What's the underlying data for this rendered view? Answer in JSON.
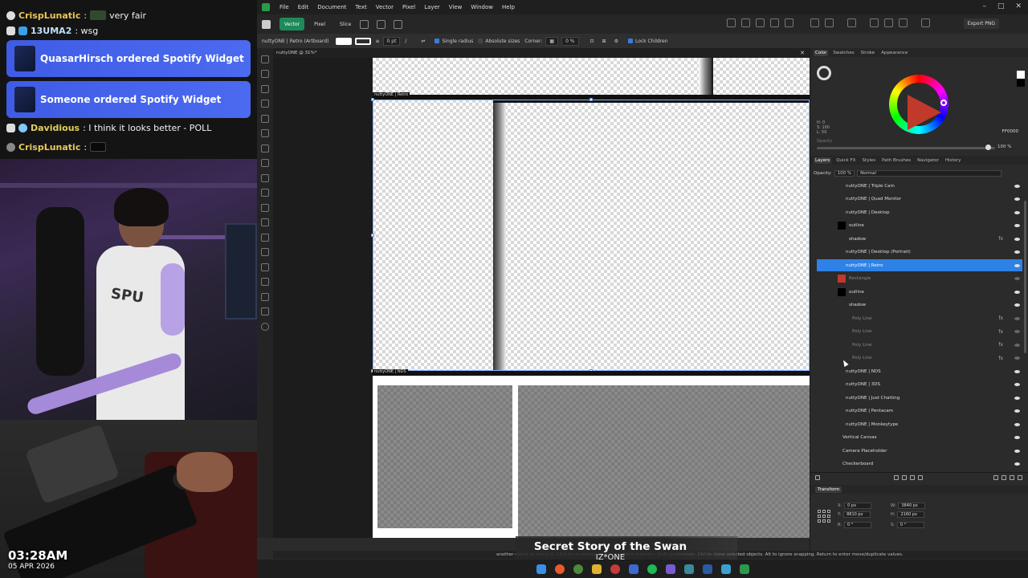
{
  "stream": {
    "chat": [
      {
        "user": "CrispLunatic",
        "message": "very fair",
        "has_emote": true
      },
      {
        "user": "13UMA2",
        "message": ": wsg",
        "has_emote": false
      },
      {
        "user": "Davidious",
        "message": ": I think it looks better - POLL",
        "has_emote": false
      },
      {
        "user": "CrispLunatic",
        "message": ":",
        "has_emote": true
      }
    ],
    "alerts": [
      {
        "text": "QuasarHirsch ordered Spotify Widget"
      },
      {
        "text": "Someone ordered Spotify Widget"
      }
    ],
    "clock": "03:28AM",
    "date": "05 APR 2026",
    "now_playing": {
      "title": "Secret Story of the Swan",
      "artist": "IZ*ONE"
    }
  },
  "app": {
    "menu": [
      "File",
      "Edit",
      "Document",
      "Text",
      "Vector",
      "Pixel",
      "Layer",
      "View",
      "Window",
      "Help"
    ],
    "personas": [
      {
        "label": "Vector",
        "active": true
      },
      {
        "label": "Pixel",
        "active": false
      },
      {
        "label": "Slice",
        "active": false
      }
    ],
    "export_label": "Export PNG",
    "context": {
      "selection_name": "nuttyONE | Retro (Artboard)",
      "stroke_width": "0 pt",
      "single_radius": "Single radius",
      "absolute_sizes": "Absolute sizes",
      "corner_label": "Corner:",
      "corner_value": "0 %",
      "lock_children": "Lock Children"
    },
    "doc_tab": "nuttyONE @ 31%*",
    "artboard_labels": [
      "nuttyONE | Retro",
      "nuttyONE | NDS"
    ],
    "status_text": "another object to select it. Click on an empty area to deselect selection. Shift to constrain. Ctrl to clone selected objects. Alt to ignore snapping. Return to enter move/duplicate values."
  },
  "panels": {
    "color_tabs": [
      "Color",
      "Swatches",
      "Stroke",
      "Appearance"
    ],
    "color": {
      "h": "H: 0",
      "s": "S: 100",
      "l": "L: 50",
      "hex": "FF0000",
      "opacity_label": "Opacity",
      "opacity_value": "100 %",
      "accent": "#ff0000"
    },
    "layer_tabs": [
      "Layers",
      "Quick FX",
      "Styles",
      "Path Brushes",
      "Navigator",
      "History"
    ],
    "layer_opacity_label": "Opacity:",
    "layer_opacity": "100 %",
    "blend_mode": "Normal",
    "layers": [
      {
        "name": "nuttyONE | Triple Cam",
        "indent": 1,
        "fx": false,
        "state": "normal"
      },
      {
        "name": "nuttyONE | Quad Monitor",
        "indent": 1,
        "fx": false,
        "state": "normal"
      },
      {
        "name": "nuttyONE | Desktop",
        "indent": 1,
        "fx": false,
        "state": "normal"
      },
      {
        "name": "outline",
        "indent": 2,
        "fx": false,
        "state": "normal"
      },
      {
        "name": "shadow",
        "indent": 2,
        "fx": true,
        "state": "normal"
      },
      {
        "name": "nuttyONE | Desktop (Portrait)",
        "indent": 1,
        "fx": false,
        "state": "normal"
      },
      {
        "name": "nuttyONE | Retro",
        "indent": 1,
        "fx": false,
        "state": "selected"
      },
      {
        "name": "Rectangle",
        "indent": 2,
        "fx": false,
        "state": "dim"
      },
      {
        "name": "outline",
        "indent": 2,
        "fx": false,
        "state": "normal"
      },
      {
        "name": "shadow",
        "indent": 2,
        "fx": false,
        "state": "normal"
      },
      {
        "name": "Poly Line",
        "indent": 3,
        "fx": true,
        "state": "dim"
      },
      {
        "name": "Poly Line",
        "indent": 3,
        "fx": true,
        "state": "dim"
      },
      {
        "name": "Poly Line",
        "indent": 3,
        "fx": true,
        "state": "dim"
      },
      {
        "name": "Poly Line",
        "indent": 3,
        "fx": true,
        "state": "dim"
      },
      {
        "name": "nuttyONE | NDS",
        "indent": 1,
        "fx": false,
        "state": "normal"
      },
      {
        "name": "nuttyONE | 3DS",
        "indent": 1,
        "fx": false,
        "state": "normal"
      },
      {
        "name": "nuttyONE | Just Chatting",
        "indent": 1,
        "fx": false,
        "state": "normal"
      },
      {
        "name": "nuttyONE | Pentacam",
        "indent": 1,
        "fx": false,
        "state": "normal"
      },
      {
        "name": "nuttyONE | Monkeytype",
        "indent": 1,
        "fx": false,
        "state": "normal"
      },
      {
        "name": "Vertical Canvas",
        "indent": 0,
        "fx": false,
        "state": "normal"
      },
      {
        "name": "Camera Placeholder",
        "indent": 0,
        "fx": false,
        "state": "normal"
      },
      {
        "name": "Checkerboard",
        "indent": 0,
        "fx": false,
        "state": "normal"
      }
    ],
    "transform_tab": "Transform",
    "transform": {
      "x_label": "X:",
      "x": "0 px",
      "y_label": "Y:",
      "y": "8810 px",
      "w_label": "W:",
      "w": "3840 px",
      "h_label": "H:",
      "h": "2160 px",
      "r_label": "R:",
      "r": "0 °",
      "s_label": "S:",
      "s": "0 °"
    }
  }
}
